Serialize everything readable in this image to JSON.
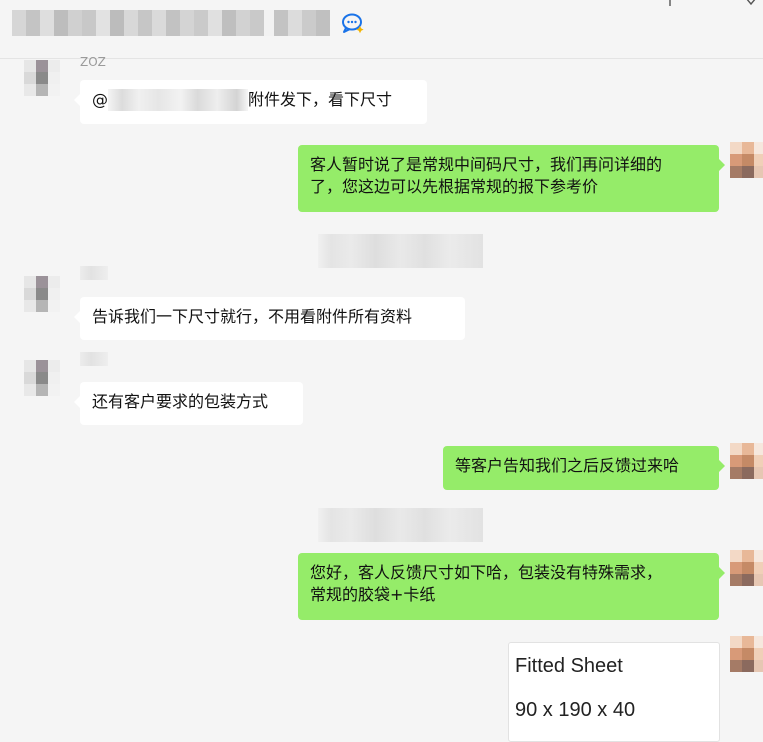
{
  "header": {
    "title": "",
    "icons": [
      "chat-bubble-icon",
      "pin-icon",
      "close-icon"
    ]
  },
  "messages": [
    {
      "side": "left",
      "sender": "ZOZ",
      "mention_prefix": "@",
      "text": "附件发下，看下尺寸"
    },
    {
      "side": "right",
      "text_line1": "客人暂时说了是常规中间码尺寸，我们再问详细的",
      "text_line2": "了，您这边可以先根据常规的报下参考价"
    },
    {
      "side": "left",
      "sender": "",
      "text": "告诉我们一下尺寸就行，不用看附件所有资料"
    },
    {
      "side": "left",
      "sender": "",
      "text": "还有客户要求的包装方式"
    },
    {
      "side": "right",
      "text": "等客户告知我们之后反馈过来哈"
    },
    {
      "side": "right",
      "text_line1": "您好，客人反馈尺寸如下哈，包装没有特殊需求，",
      "text_line2": "常规的胶袋+卡纸"
    },
    {
      "side": "right",
      "type": "attachment",
      "line1": "Fitted Sheet",
      "line2": "90 x 190 x 40"
    }
  ],
  "colors": {
    "background": "#f5f5f5",
    "bubble_left": "#ffffff",
    "bubble_right": "#95ec69",
    "accent_icon": "#1a73e8"
  }
}
